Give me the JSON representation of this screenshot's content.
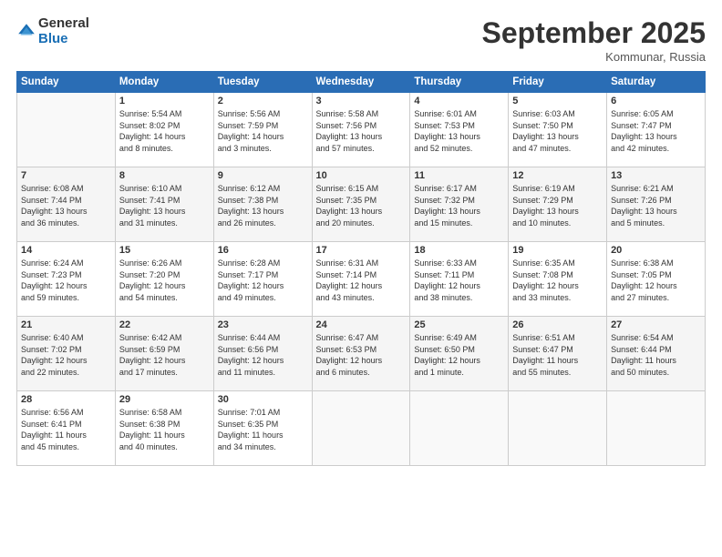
{
  "logo": {
    "general": "General",
    "blue": "Blue"
  },
  "title": "September 2025",
  "location": "Kommunar, Russia",
  "days_of_week": [
    "Sunday",
    "Monday",
    "Tuesday",
    "Wednesday",
    "Thursday",
    "Friday",
    "Saturday"
  ],
  "weeks": [
    [
      {
        "day": "",
        "info": ""
      },
      {
        "day": "1",
        "info": "Sunrise: 5:54 AM\nSunset: 8:02 PM\nDaylight: 14 hours\nand 8 minutes."
      },
      {
        "day": "2",
        "info": "Sunrise: 5:56 AM\nSunset: 7:59 PM\nDaylight: 14 hours\nand 3 minutes."
      },
      {
        "day": "3",
        "info": "Sunrise: 5:58 AM\nSunset: 7:56 PM\nDaylight: 13 hours\nand 57 minutes."
      },
      {
        "day": "4",
        "info": "Sunrise: 6:01 AM\nSunset: 7:53 PM\nDaylight: 13 hours\nand 52 minutes."
      },
      {
        "day": "5",
        "info": "Sunrise: 6:03 AM\nSunset: 7:50 PM\nDaylight: 13 hours\nand 47 minutes."
      },
      {
        "day": "6",
        "info": "Sunrise: 6:05 AM\nSunset: 7:47 PM\nDaylight: 13 hours\nand 42 minutes."
      }
    ],
    [
      {
        "day": "7",
        "info": "Sunrise: 6:08 AM\nSunset: 7:44 PM\nDaylight: 13 hours\nand 36 minutes."
      },
      {
        "day": "8",
        "info": "Sunrise: 6:10 AM\nSunset: 7:41 PM\nDaylight: 13 hours\nand 31 minutes."
      },
      {
        "day": "9",
        "info": "Sunrise: 6:12 AM\nSunset: 7:38 PM\nDaylight: 13 hours\nand 26 minutes."
      },
      {
        "day": "10",
        "info": "Sunrise: 6:15 AM\nSunset: 7:35 PM\nDaylight: 13 hours\nand 20 minutes."
      },
      {
        "day": "11",
        "info": "Sunrise: 6:17 AM\nSunset: 7:32 PM\nDaylight: 13 hours\nand 15 minutes."
      },
      {
        "day": "12",
        "info": "Sunrise: 6:19 AM\nSunset: 7:29 PM\nDaylight: 13 hours\nand 10 minutes."
      },
      {
        "day": "13",
        "info": "Sunrise: 6:21 AM\nSunset: 7:26 PM\nDaylight: 13 hours\nand 5 minutes."
      }
    ],
    [
      {
        "day": "14",
        "info": "Sunrise: 6:24 AM\nSunset: 7:23 PM\nDaylight: 12 hours\nand 59 minutes."
      },
      {
        "day": "15",
        "info": "Sunrise: 6:26 AM\nSunset: 7:20 PM\nDaylight: 12 hours\nand 54 minutes."
      },
      {
        "day": "16",
        "info": "Sunrise: 6:28 AM\nSunset: 7:17 PM\nDaylight: 12 hours\nand 49 minutes."
      },
      {
        "day": "17",
        "info": "Sunrise: 6:31 AM\nSunset: 7:14 PM\nDaylight: 12 hours\nand 43 minutes."
      },
      {
        "day": "18",
        "info": "Sunrise: 6:33 AM\nSunset: 7:11 PM\nDaylight: 12 hours\nand 38 minutes."
      },
      {
        "day": "19",
        "info": "Sunrise: 6:35 AM\nSunset: 7:08 PM\nDaylight: 12 hours\nand 33 minutes."
      },
      {
        "day": "20",
        "info": "Sunrise: 6:38 AM\nSunset: 7:05 PM\nDaylight: 12 hours\nand 27 minutes."
      }
    ],
    [
      {
        "day": "21",
        "info": "Sunrise: 6:40 AM\nSunset: 7:02 PM\nDaylight: 12 hours\nand 22 minutes."
      },
      {
        "day": "22",
        "info": "Sunrise: 6:42 AM\nSunset: 6:59 PM\nDaylight: 12 hours\nand 17 minutes."
      },
      {
        "day": "23",
        "info": "Sunrise: 6:44 AM\nSunset: 6:56 PM\nDaylight: 12 hours\nand 11 minutes."
      },
      {
        "day": "24",
        "info": "Sunrise: 6:47 AM\nSunset: 6:53 PM\nDaylight: 12 hours\nand 6 minutes."
      },
      {
        "day": "25",
        "info": "Sunrise: 6:49 AM\nSunset: 6:50 PM\nDaylight: 12 hours\nand 1 minute."
      },
      {
        "day": "26",
        "info": "Sunrise: 6:51 AM\nSunset: 6:47 PM\nDaylight: 11 hours\nand 55 minutes."
      },
      {
        "day": "27",
        "info": "Sunrise: 6:54 AM\nSunset: 6:44 PM\nDaylight: 11 hours\nand 50 minutes."
      }
    ],
    [
      {
        "day": "28",
        "info": "Sunrise: 6:56 AM\nSunset: 6:41 PM\nDaylight: 11 hours\nand 45 minutes."
      },
      {
        "day": "29",
        "info": "Sunrise: 6:58 AM\nSunset: 6:38 PM\nDaylight: 11 hours\nand 40 minutes."
      },
      {
        "day": "30",
        "info": "Sunrise: 7:01 AM\nSunset: 6:35 PM\nDaylight: 11 hours\nand 34 minutes."
      },
      {
        "day": "",
        "info": ""
      },
      {
        "day": "",
        "info": ""
      },
      {
        "day": "",
        "info": ""
      },
      {
        "day": "",
        "info": ""
      }
    ]
  ]
}
